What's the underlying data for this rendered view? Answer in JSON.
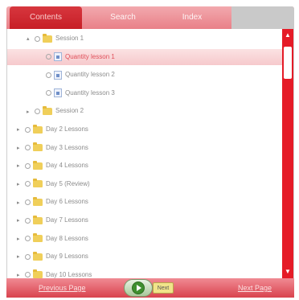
{
  "tabs": [
    {
      "label": "Contents"
    },
    {
      "label": "Search"
    },
    {
      "label": "Index"
    }
  ],
  "tree": [
    {
      "label": "Session 1",
      "type": "folder",
      "expanded": true,
      "level": 1
    },
    {
      "label": "Quantity lesson 1",
      "type": "doc",
      "level": 2,
      "selected": true
    },
    {
      "label": "Quantity lesson 2",
      "type": "doc",
      "level": 2
    },
    {
      "label": "Quantity lesson 3",
      "type": "doc",
      "level": 2
    },
    {
      "label": "Session 2",
      "type": "folder",
      "expanded": false,
      "level": 1
    },
    {
      "label": "Day 2 Lessons",
      "type": "folder",
      "expanded": false,
      "level": 0
    },
    {
      "label": "Day 3 Lessons",
      "type": "folder",
      "expanded": false,
      "level": 0
    },
    {
      "label": "Day 4 Lessons",
      "type": "folder",
      "expanded": false,
      "level": 0
    },
    {
      "label": "Day 5 (Review)",
      "type": "folder",
      "expanded": false,
      "level": 0
    },
    {
      "label": "Day 6 Lessons",
      "type": "folder",
      "expanded": false,
      "level": 0
    },
    {
      "label": "Day 7 Lessons",
      "type": "folder",
      "expanded": false,
      "level": 0
    },
    {
      "label": "Day 8 Lessons",
      "type": "folder",
      "expanded": false,
      "level": 0
    },
    {
      "label": "Day 9 Lessons",
      "type": "folder",
      "expanded": false,
      "level": 0
    },
    {
      "label": "Day 10 Lessons",
      "type": "folder",
      "expanded": false,
      "level": 0
    }
  ],
  "footer": {
    "prev_label": "Previous Page",
    "next_label": "Next Page",
    "next_pill_label": "Next"
  },
  "colors": {
    "accent": "#e51b27",
    "tab_active": "#c4141c",
    "selection": "#f6c9cc"
  },
  "icons": {
    "folder": "folder-icon",
    "document": "document-icon",
    "play": "play-icon"
  }
}
